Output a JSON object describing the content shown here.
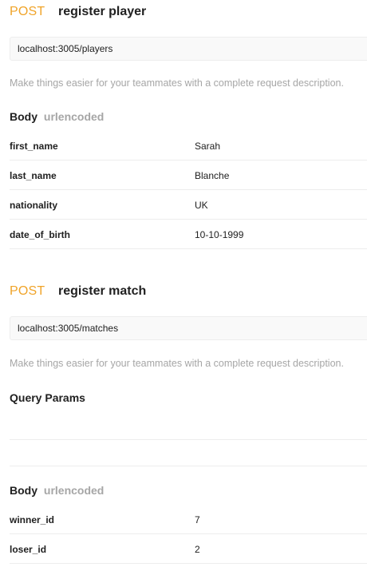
{
  "requests": [
    {
      "method": "POST",
      "name": "register player",
      "url": "localhost:3005/players",
      "description": "Make things easier for your teammates with a complete request description.",
      "body": {
        "label": "Body",
        "mode": "urlencoded",
        "params": [
          {
            "key": "first_name",
            "value": "Sarah"
          },
          {
            "key": "last_name",
            "value": "Blanche"
          },
          {
            "key": "nationality",
            "value": "UK"
          },
          {
            "key": "date_of_birth",
            "value": "10-10-1999"
          }
        ]
      }
    },
    {
      "method": "POST",
      "name": "register match",
      "url": "localhost:3005/matches",
      "description": "Make things easier for your teammates with a complete request description.",
      "query": {
        "label": "Query Params"
      },
      "body": {
        "label": "Body",
        "mode": "urlencoded",
        "params": [
          {
            "key": "winner_id",
            "value": "7"
          },
          {
            "key": "loser_id",
            "value": "2"
          }
        ]
      }
    }
  ]
}
